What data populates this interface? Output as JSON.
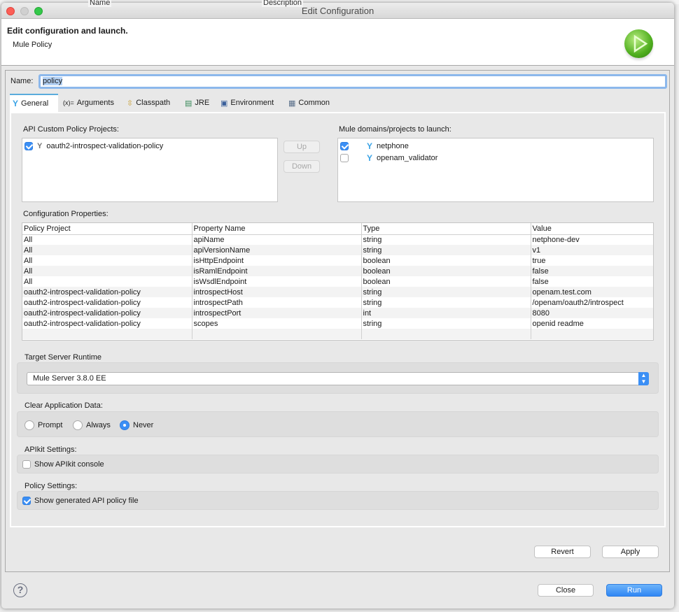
{
  "background_window": {
    "columns": [
      "Name",
      "Description"
    ]
  },
  "window": {
    "title": "Edit Configuration"
  },
  "header": {
    "title": "Edit configuration and launch.",
    "subtitle": "Mule Policy",
    "icon": "run-play-icon"
  },
  "name_field": {
    "label": "Name:",
    "value": "policy"
  },
  "tabs": [
    {
      "label": "General",
      "icon": "mule-icon",
      "selected": true
    },
    {
      "label": "Arguments",
      "icon": "variable-icon"
    },
    {
      "label": "Classpath",
      "icon": "classpath-icon"
    },
    {
      "label": "JRE",
      "icon": "library-icon"
    },
    {
      "label": "Environment",
      "icon": "environment-icon"
    },
    {
      "label": "Common",
      "icon": "table-icon"
    }
  ],
  "policy_projects": {
    "label": "API Custom Policy Projects:",
    "items": [
      {
        "label": "oauth2-introspect-validation-policy",
        "checked": true
      }
    ],
    "up_label": "Up",
    "down_label": "Down"
  },
  "mule_projects": {
    "label": "Mule domains/projects to launch:",
    "items": [
      {
        "label": "netphone",
        "checked": true
      },
      {
        "label": "openam_validator",
        "checked": false
      }
    ]
  },
  "config_properties": {
    "label": "Configuration Properties:",
    "columns": [
      "Policy Project",
      "Property Name",
      "Type",
      "Value"
    ],
    "rows": [
      [
        "All",
        "apiName",
        "string",
        "netphone-dev"
      ],
      [
        "All",
        "apiVersionName",
        "string",
        "v1"
      ],
      [
        "All",
        "isHttpEndpoint",
        "boolean",
        "true"
      ],
      [
        "All",
        "isRamlEndpoint",
        "boolean",
        "false"
      ],
      [
        "All",
        "isWsdlEndpoint",
        "boolean",
        "false"
      ],
      [
        "oauth2-introspect-validation-policy",
        "introspectHost",
        "string",
        "openam.test.com"
      ],
      [
        "oauth2-introspect-validation-policy",
        "introspectPath",
        "string",
        "/openam/oauth2/introspect"
      ],
      [
        "oauth2-introspect-validation-policy",
        "introspectPort",
        "int",
        "8080"
      ],
      [
        "oauth2-introspect-validation-policy",
        "scopes",
        "string",
        "openid readme"
      ]
    ]
  },
  "runtime": {
    "label": "Target Server Runtime",
    "selected": "Mule Server 3.8.0 EE"
  },
  "clear_data": {
    "label": "Clear Application Data:",
    "options": [
      "Prompt",
      "Always",
      "Never"
    ],
    "selected": "Never"
  },
  "apikit": {
    "label": "APIkit Settings:",
    "checkbox": "Show APIkit console",
    "checked": false
  },
  "policy_settings": {
    "label": "Policy Settings:",
    "checkbox": "Show generated API policy file",
    "checked": true
  },
  "buttons": {
    "revert": "Revert",
    "apply": "Apply",
    "close": "Close",
    "run": "Run",
    "help": "?"
  },
  "colors": {
    "accent": "#3b8ff5",
    "mule_blue": "#3aa3e6"
  }
}
